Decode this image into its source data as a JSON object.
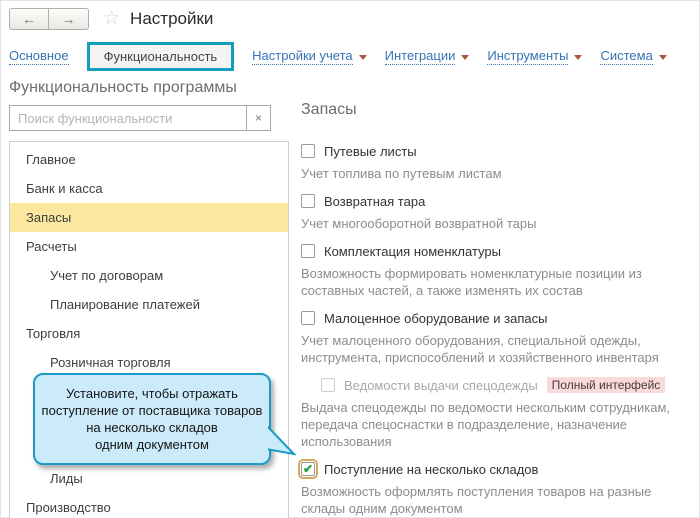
{
  "colors": {
    "accent_teal": "#129fbc",
    "link_blue": "#3673b5",
    "selection_yellow": "#fbe79d",
    "callout_fill": "#cbebfa",
    "callout_border": "#1b9ac4",
    "check_green": "#1fa038",
    "focus_ring": "#d9a75b",
    "badge_pink": "#f8dada"
  },
  "header": {
    "title": "Настройки",
    "back_arrow": "←",
    "forward_arrow": "→",
    "star": "☆"
  },
  "tabs": [
    {
      "label": "Основное",
      "type": "link",
      "dropdown": false
    },
    {
      "label": "Функциональность",
      "type": "selected",
      "dropdown": false
    },
    {
      "label": "Настройки учета",
      "type": "link",
      "dropdown": true
    },
    {
      "label": "Интеграции",
      "type": "link",
      "dropdown": true
    },
    {
      "label": "Инструменты",
      "type": "link",
      "dropdown": true
    },
    {
      "label": "Система",
      "type": "link",
      "dropdown": true
    }
  ],
  "page_heading": "Функциональность программы",
  "search": {
    "placeholder": "Поиск функциональности",
    "clear_label": "×"
  },
  "sidebar": [
    {
      "label": "Главное",
      "level": 1,
      "selected": false,
      "gap_before": false
    },
    {
      "label": "Банк и касса",
      "level": 1,
      "selected": false,
      "gap_before": false
    },
    {
      "label": "Запасы",
      "level": 1,
      "selected": true,
      "gap_before": false
    },
    {
      "label": "Расчеты",
      "level": 1,
      "selected": false,
      "gap_before": false
    },
    {
      "label": "Учет по договорам",
      "level": 2,
      "selected": false,
      "gap_before": false
    },
    {
      "label": "Планирование платежей",
      "level": 2,
      "selected": false,
      "gap_before": false
    },
    {
      "label": "Торговля",
      "level": 1,
      "selected": false,
      "gap_before": false
    },
    {
      "label": "Розничная торговля",
      "level": 2,
      "selected": false,
      "gap_before": false
    },
    {
      "label": "Лиды",
      "level": 2,
      "selected": false,
      "gap_before": true
    },
    {
      "label": "Производство",
      "level": 1,
      "selected": false,
      "gap_before": false
    }
  ],
  "callout": {
    "lines": [
      "Установите, чтобы отражать",
      "поступление от поставщика товаров",
      "на несколько складов",
      "одним документом"
    ]
  },
  "panel": {
    "heading": "Запасы",
    "features": [
      {
        "label": "Путевые листы",
        "checked": false,
        "disabled": false,
        "indented": false,
        "focused": false,
        "badge": "",
        "description": "Учет топлива по путевым листам"
      },
      {
        "label": "Возвратная тара",
        "checked": false,
        "disabled": false,
        "indented": false,
        "focused": false,
        "badge": "",
        "description": "Учет многооборотной возвратной тары"
      },
      {
        "label": "Комплектация номенклатуры",
        "checked": false,
        "disabled": false,
        "indented": false,
        "focused": false,
        "badge": "",
        "description": "Возможность формировать номенклатурные позиции из составных частей, а также изменять их состав"
      },
      {
        "label": "Малоценное оборудование и запасы",
        "checked": false,
        "disabled": false,
        "indented": false,
        "focused": false,
        "badge": "",
        "description": "Учет малоценного оборудования, специальной одежды, инструмента, приспособлений и хозяйственного инвентаря"
      },
      {
        "label": "Ведомости выдачи спецодежды",
        "checked": false,
        "disabled": true,
        "indented": true,
        "focused": false,
        "badge": "Полный интерфейс",
        "description": "Выдача спецодежды по ведомости нескольким сотрудникам, передача спецоснастки в подразделение, назначение использования"
      },
      {
        "label": "Поступление на несколько складов",
        "checked": true,
        "disabled": false,
        "indented": false,
        "focused": true,
        "badge": "",
        "description": "Возможность оформлять поступления товаров на разные склады одним документом"
      }
    ]
  }
}
